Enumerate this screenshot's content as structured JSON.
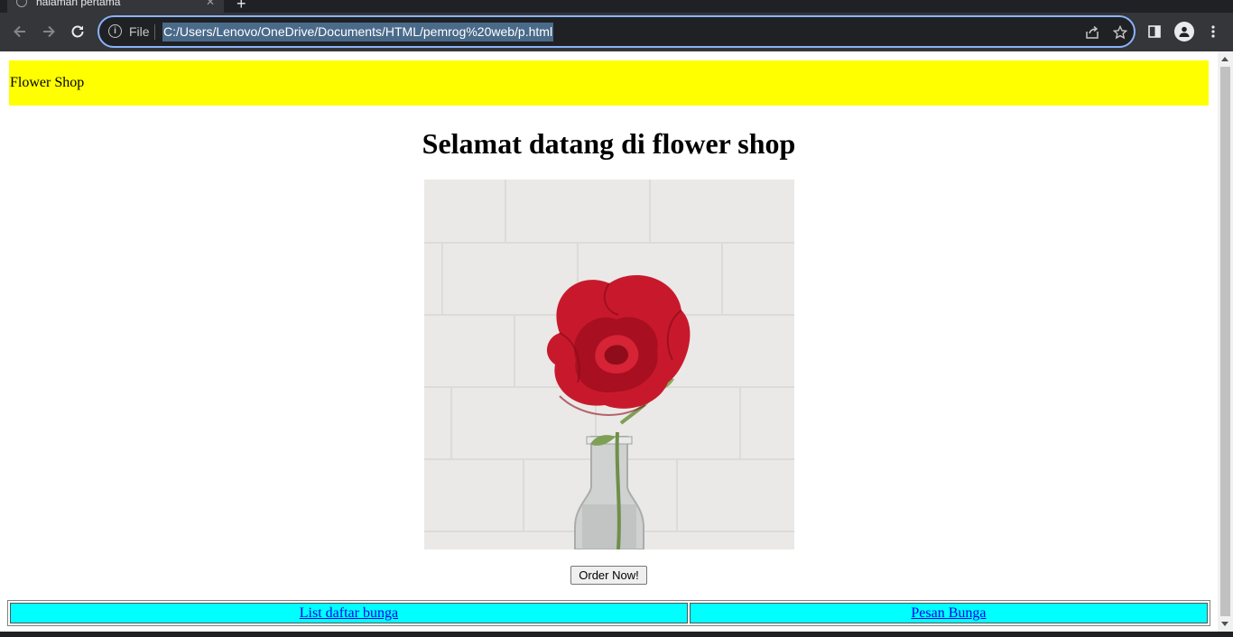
{
  "browser": {
    "tab_title": "halaman pertama",
    "tab_close": "✕",
    "new_tab": "+",
    "file_label": "File",
    "url": "C:/Users/Lenovo/OneDrive/Documents/HTML/pemrog%20web/p.html"
  },
  "page": {
    "header_text": "Flower Shop",
    "welcome_heading": "Selamat datang di flower shop",
    "image_alt": "red rose in a glass vase",
    "order_button_label": "Order Now!",
    "nav_links": [
      {
        "label": "List daftar bunga"
      },
      {
        "label": "Pesan Bunga"
      }
    ]
  },
  "colors": {
    "header_bg": "#ffff00",
    "nav_cell_bg": "#00ffff",
    "link": "#0000ee",
    "omnibox_focus": "#8ab4f8"
  }
}
